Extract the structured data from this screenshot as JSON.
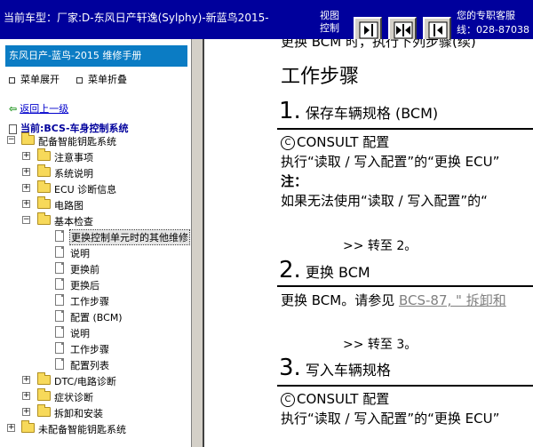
{
  "top_bar": {
    "current_car": "当前车型：厂家:D-东风日产轩逸(Sylphy)-新蓝鸟2015-",
    "view_control": "视图控制",
    "support_line1": "您的专职客服",
    "support_line2": "线：028-87038"
  },
  "left": {
    "manual_title": "东风日产-蓝鸟-2015 维修手册",
    "expand_label": "菜单展开",
    "collapse_label": "菜单折叠",
    "back_label": "返回上一级",
    "current_label": "当前:BCS-车身控制系统",
    "tree": [
      {
        "label": "配备智能钥匙系统"
      },
      {
        "label": "注意事项"
      },
      {
        "label": "系统说明"
      },
      {
        "label": "ECU 诊断信息"
      },
      {
        "label": "电路图"
      },
      {
        "label": "基本检查"
      },
      {
        "label": "更换控制单元时的其他维修"
      },
      {
        "label": "说明"
      },
      {
        "label": "更换前"
      },
      {
        "label": "更换后"
      },
      {
        "label": "工作步骤"
      },
      {
        "label": "配置 (BCM)"
      },
      {
        "label": "说明"
      },
      {
        "label": "工作步骤"
      },
      {
        "label": "配置列表"
      },
      {
        "label": "DTC/电路诊断"
      },
      {
        "label": "症状诊断"
      },
      {
        "label": "拆卸和安装"
      },
      {
        "label": "未配备智能钥匙系统"
      }
    ]
  },
  "content": {
    "top_cut": "更换 BCM 时，执行下列步骤(续)",
    "heading": "工作步骤",
    "step1_num": "1.",
    "step1_title": "保存车辆规格 (BCM)",
    "consult1": "CONSULT 配置",
    "para1": "执行“读取 / 写入配置”的“更换 ECU”",
    "note_label": "注：",
    "note_text": "如果无法使用“读取 / 写入配置”的“",
    "goto2": ">> 转至 2。",
    "step2_num": "2.",
    "step2_title": "更换 BCM",
    "para2_pre": "更换 BCM。请参见 ",
    "para2_link": "BCS-87, \" 拆卸和",
    "goto3": ">> 转至 3。",
    "step3_num": "3.",
    "step3_title": "写入车辆规格",
    "consult3": "CONSULT 配置",
    "para3": "执行“读取 / 写入配置”的“更换 ECU”",
    "consult_icon": "consult-icon"
  }
}
